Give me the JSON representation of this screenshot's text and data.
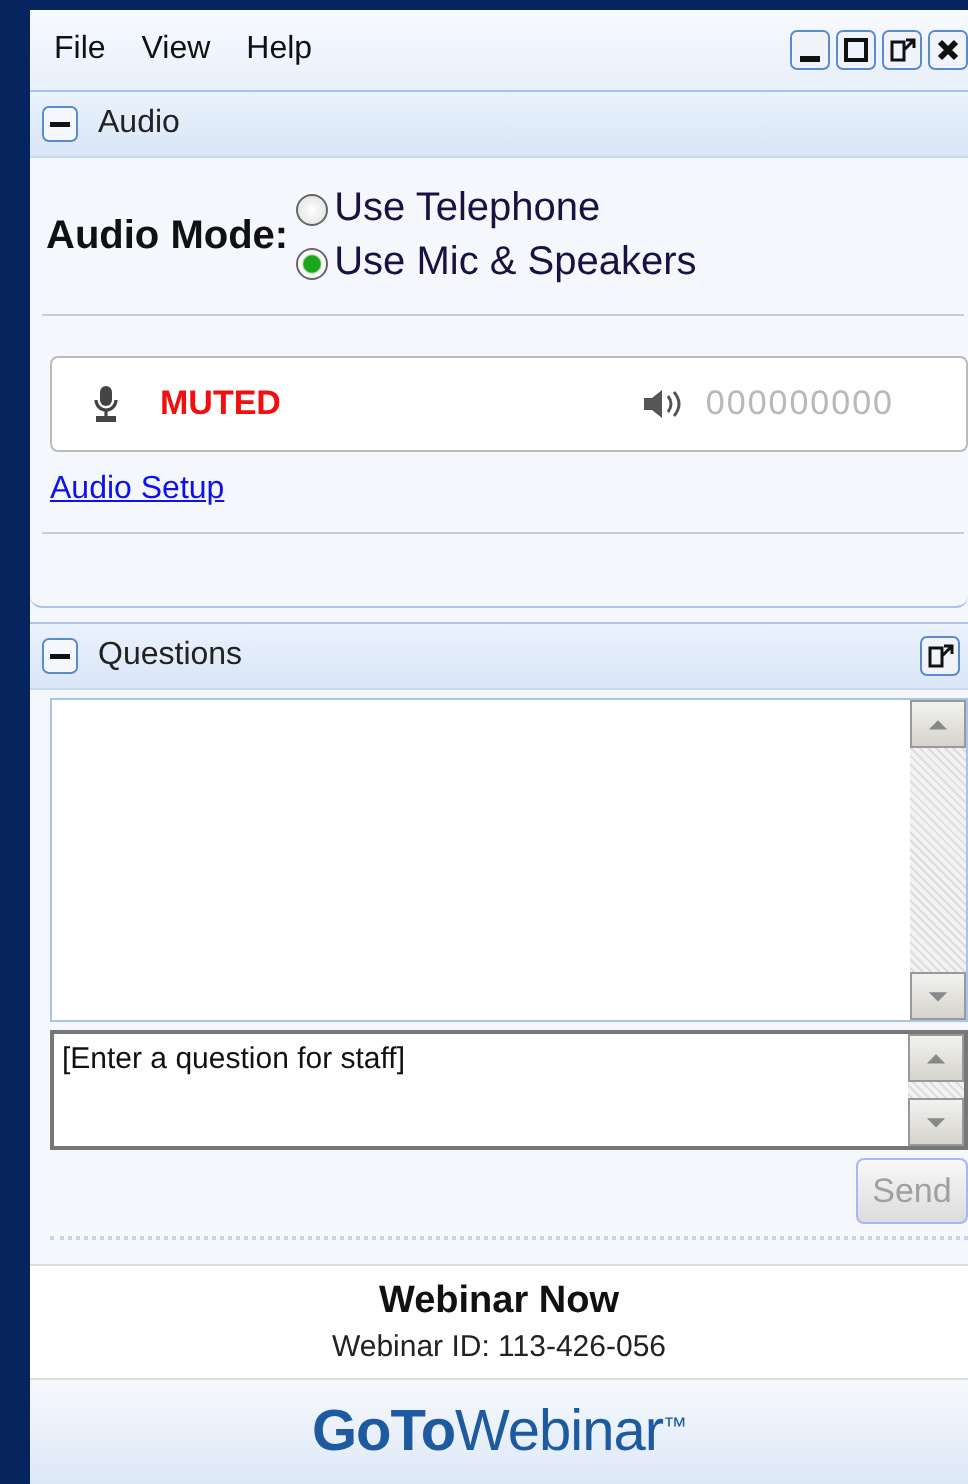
{
  "menu": [
    "File",
    "View",
    "Help"
  ],
  "audio": {
    "title": "Audio",
    "expanded": true,
    "mode_label": "Audio Mode:",
    "modes": [
      {
        "label": "Use Telephone",
        "selected": false
      },
      {
        "label": "Use Mic & Speakers",
        "selected": true
      }
    ],
    "mic_status": "MUTED",
    "speaker_level": "000000000",
    "setup_link": "Audio Setup"
  },
  "questions": {
    "title": "Questions",
    "expanded": true,
    "placeholder": "[Enter a question for staff]",
    "send": {
      "label": "Send",
      "disabled": true
    }
  },
  "footer": {
    "title": "Webinar Now",
    "webinar_id": "Webinar ID: 113-426-056"
  },
  "logo": {
    "bold": "GoTo",
    "light": "Webinar",
    "mark": "™"
  }
}
